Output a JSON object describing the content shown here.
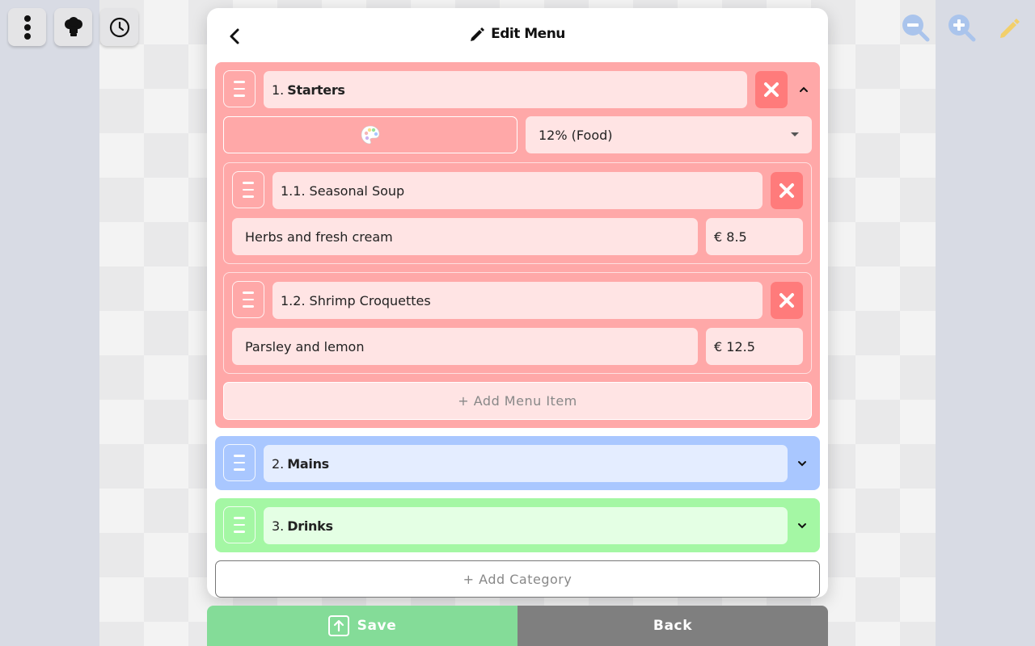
{
  "toolbar": {
    "menu_icon": "more-vertical-icon",
    "chef_icon": "chef-hat-icon",
    "clock_icon": "clock-icon",
    "zoom_out_icon": "zoom-out-icon",
    "zoom_in_icon": "zoom-in-icon",
    "edit_icon": "pencil-icon"
  },
  "modal": {
    "title": "Edit Menu",
    "back_icon": "chevron-left-icon",
    "title_icon": "pencil-icon"
  },
  "categories": [
    {
      "number": "1.",
      "name": "Starters",
      "color": "#ffa8a8",
      "expanded": true,
      "vat": "12% (Food)",
      "palette_icon": "palette-icon",
      "items": [
        {
          "number": "1.1.",
          "name": "Seasonal Soup",
          "description": "Herbs and fresh cream",
          "price": "€ 8.5"
        },
        {
          "number": "1.2.",
          "name": "Shrimp Croquettes",
          "description": "Parsley and lemon",
          "price": "€ 12.5"
        }
      ],
      "add_item_label": "+ Add Menu Item"
    },
    {
      "number": "2.",
      "name": "Mains",
      "color": "#a9c7ff",
      "expanded": false
    },
    {
      "number": "3.",
      "name": "Drinks",
      "color": "#a4f7a4",
      "expanded": false
    }
  ],
  "add_category_label": "+ Add Category",
  "footer": {
    "save_label": "Save",
    "back_label": "Back",
    "save_color": "#84dc98",
    "back_color": "#7f7f7f"
  }
}
